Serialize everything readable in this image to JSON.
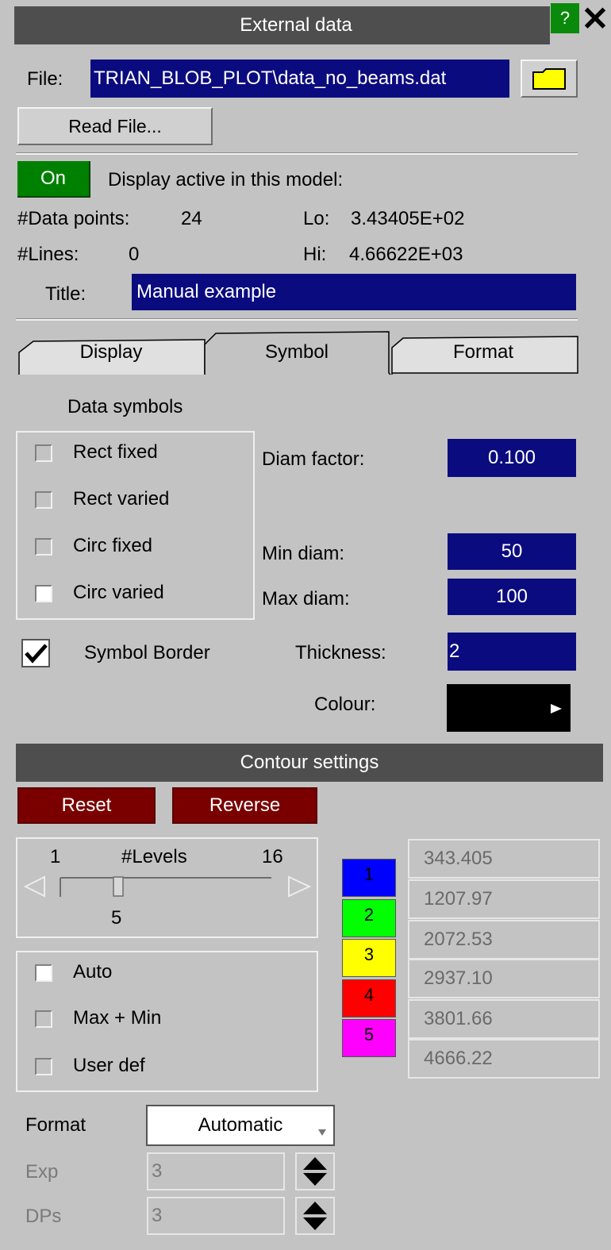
{
  "window": {
    "title": "External data",
    "help": "?",
    "close": "✕"
  },
  "file": {
    "label": "File:",
    "value": "TRIAN_BLOB_PLOT\\data_no_beams.dat",
    "read_button": "Read File..."
  },
  "display": {
    "toggle": "On",
    "label": "Display active in this model:"
  },
  "stats": {
    "points_label": "#Data points:",
    "points_value": "24",
    "lines_label": "#Lines:",
    "lines_value": "0",
    "lo_label": "Lo:",
    "lo_value": "3.43405E+02",
    "hi_label": "Hi:",
    "hi_value": "4.66622E+03"
  },
  "title_field": {
    "label": "Title:",
    "value": "Manual example"
  },
  "tabs": [
    {
      "label": "Display",
      "active": false
    },
    {
      "label": "Symbol",
      "active": true
    },
    {
      "label": "Format",
      "active": false
    }
  ],
  "symbols": {
    "heading": "Data symbols",
    "options": [
      {
        "label": "Rect fixed",
        "checked": false
      },
      {
        "label": "Rect varied",
        "checked": false
      },
      {
        "label": "Circ fixed",
        "checked": false
      },
      {
        "label": "Circ varied",
        "checked": true
      }
    ],
    "diam_factor_label": "Diam factor:",
    "diam_factor_value": "0.100",
    "min_diam_label": "Min diam:",
    "min_diam_value": "50",
    "max_diam_label": "Max diam:",
    "max_diam_value": "100",
    "border_label": "Symbol Border",
    "border_checked": true,
    "thickness_label": "Thickness:",
    "thickness_value": "2",
    "colour_label": "Colour:",
    "colour_value": "#000000"
  },
  "contour": {
    "header": "Contour settings",
    "reset": "Reset",
    "reverse": "Reverse",
    "levels_min": "1",
    "levels_label": "#Levels",
    "levels_max": "16",
    "levels_value": "5",
    "mode_options": [
      {
        "label": "Auto",
        "selected": true
      },
      {
        "label": "Max + Min",
        "selected": false
      },
      {
        "label": "User def",
        "selected": false
      }
    ],
    "levels": [
      {
        "n": "1",
        "color": "#0000ff"
      },
      {
        "n": "2",
        "color": "#00ff00"
      },
      {
        "n": "3",
        "color": "#ffff00"
      },
      {
        "n": "4",
        "color": "#ff0000"
      },
      {
        "n": "5",
        "color": "#ff00ff"
      }
    ],
    "values": [
      "343.405",
      "1207.97",
      "2072.53",
      "2937.10",
      "3801.66",
      "4666.22"
    ],
    "format_label": "Format",
    "format_value": "Automatic",
    "exp_label": "Exp",
    "exp_value": "3",
    "dps_label": "DPs",
    "dps_value": "3"
  }
}
